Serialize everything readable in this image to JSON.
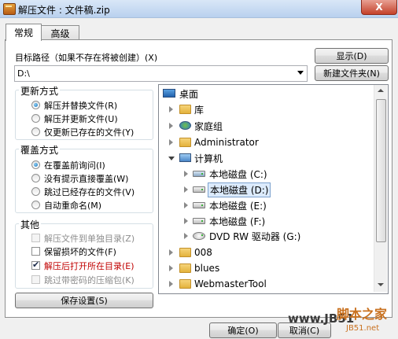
{
  "window": {
    "title": "解压文件 : 文件稿.zip",
    "close": "X"
  },
  "tabs": [
    {
      "label": "常规"
    },
    {
      "label": "高级"
    }
  ],
  "dest": {
    "label": "目标路径（如果不存在将被创建）(X)",
    "value": "D:\\",
    "show_button": "显示(D)",
    "new_folder_button": "新建文件夹(N)"
  },
  "update_group": {
    "title": "更新方式",
    "options": [
      {
        "label": "解压并替换文件(R)",
        "selected": true
      },
      {
        "label": "解压并更新文件(U)",
        "selected": false
      },
      {
        "label": "仅更新已存在的文件(Y)",
        "selected": false
      }
    ]
  },
  "overwrite_group": {
    "title": "覆盖方式",
    "options": [
      {
        "label": "在覆盖前询问(I)",
        "selected": true
      },
      {
        "label": "没有提示直接覆盖(W)",
        "selected": false
      },
      {
        "label": "跳过已经存在的文件(V)",
        "selected": false
      },
      {
        "label": "自动重命名(M)",
        "selected": false
      }
    ]
  },
  "misc_group": {
    "title": "其他",
    "options": [
      {
        "label": "解压文件到单独目录(Z)",
        "checked": false,
        "disabled": true
      },
      {
        "label": "保留损坏的文件(F)",
        "checked": false,
        "disabled": false
      },
      {
        "label": "解压后打开所在目录(E)",
        "checked": true,
        "disabled": false
      },
      {
        "label": "跳过带密码的压缩包(K)",
        "checked": false,
        "disabled": true
      }
    ]
  },
  "save_button": "保存设置(S)",
  "tree": [
    {
      "label": "桌面",
      "icon": "desktop-icon",
      "expander": "none"
    },
    {
      "label": "库",
      "icon": "folder-icon",
      "expander": "closed"
    },
    {
      "label": "家庭组",
      "icon": "homegroup-icon",
      "expander": "closed"
    },
    {
      "label": "Administrator",
      "icon": "folder-icon",
      "expander": "closed"
    },
    {
      "label": "计算机",
      "icon": "computer-icon",
      "expander": "open"
    },
    {
      "label": "本地磁盘 (C:)",
      "icon": "drive-icon",
      "expander": "closed"
    },
    {
      "label": "本地磁盘 (D:)",
      "icon": "drive-icon",
      "expander": "closed",
      "selected": true
    },
    {
      "label": "本地磁盘 (E:)",
      "icon": "drive-icon",
      "expander": "closed"
    },
    {
      "label": "本地磁盘 (F:)",
      "icon": "drive-icon",
      "expander": "closed"
    },
    {
      "label": "DVD RW 驱动器 (G:)",
      "icon": "dvd-icon",
      "expander": "closed"
    },
    {
      "label": "008",
      "icon": "folder-icon",
      "expander": "closed"
    },
    {
      "label": "blues",
      "icon": "folder-icon",
      "expander": "closed"
    },
    {
      "label": "WebmasterTool",
      "icon": "folder-icon",
      "expander": "closed"
    }
  ],
  "ok_button": "确定(O)",
  "cancel_button": "取消(C)",
  "watermark": {
    "brand": "www.JB51",
    "cn": "脚本之家",
    "url": "JB51.net"
  }
}
